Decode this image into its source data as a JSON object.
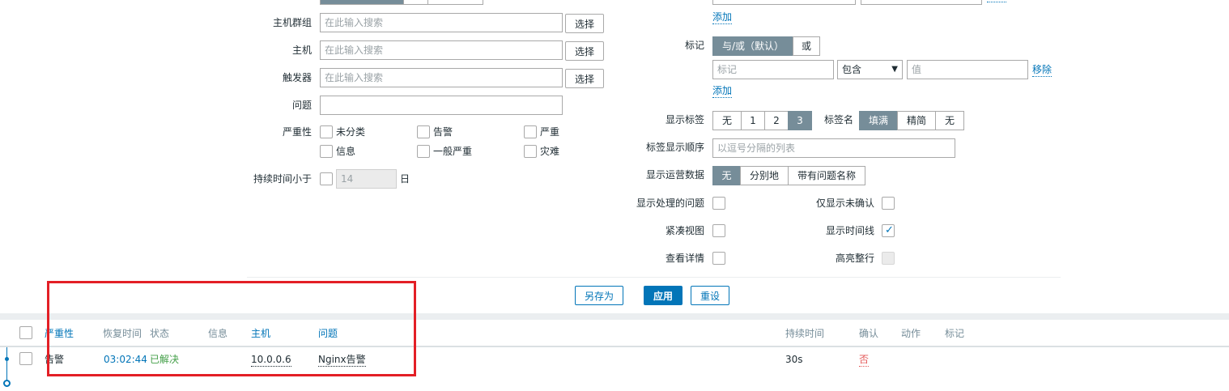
{
  "filter": {
    "host_groups": {
      "label": "主机群组",
      "placeholder": "在此输入搜索",
      "select_label": "选择"
    },
    "hosts": {
      "label": "主机",
      "placeholder": "在此输入搜索",
      "select_label": "选择"
    },
    "triggers": {
      "label": "触发器",
      "placeholder": "在此输入搜索",
      "select_label": "选择"
    },
    "problem": {
      "label": "问题",
      "value": ""
    },
    "severity": {
      "label": "严重性",
      "options": [
        "未分类",
        "告警",
        "严重",
        "信息",
        "一般严重",
        "灾难"
      ]
    },
    "age": {
      "label": "持续时间小于",
      "value": "14",
      "unit": "日"
    },
    "top_add_link": "添加",
    "tags": {
      "label": "标记",
      "operators": [
        "与/或（默认）",
        "或"
      ],
      "tag_placeholder": "标记",
      "condition": "包含",
      "value_placeholder": "值",
      "remove_label": "移除",
      "add_label": "添加"
    },
    "show_tags": {
      "label": "显示标签",
      "options": [
        "无",
        "1",
        "2",
        "3"
      ],
      "selected": "3"
    },
    "tag_name": {
      "label": "标签名",
      "options": [
        "填满",
        "精简",
        "无"
      ],
      "selected": "填满"
    },
    "tag_priority": {
      "label": "标签显示顺序",
      "placeholder": "以逗号分隔的列表"
    },
    "show_opdata": {
      "label": "显示运营数据",
      "options": [
        "无",
        "分别地",
        "带有问题名称"
      ],
      "selected": "无"
    },
    "show_suppressed": {
      "label": "显示处理的问题",
      "checked": false
    },
    "unacknowledged_only": {
      "label": "仅显示未确认",
      "checked": false
    },
    "compact_view": {
      "label": "紧凑视图",
      "checked": false
    },
    "show_timeline": {
      "label": "显示时间线",
      "checked": true
    },
    "show_details": {
      "label": "查看详情",
      "checked": false
    },
    "highlight_row": {
      "label": "高亮整行",
      "checked": false
    },
    "buttons": {
      "save_as": "另存为",
      "apply": "应用",
      "reset": "重设"
    }
  },
  "table": {
    "headers": {
      "severity": "严重性",
      "recovery_time": "恢复时间",
      "status": "状态",
      "info": "信息",
      "host": "主机",
      "problem": "问题",
      "duration": "持续时间",
      "ack": "确认",
      "actions": "动作",
      "tags": "标记"
    },
    "rows": [
      {
        "severity": "告警",
        "recovery_time": "03:02:44",
        "status": "已解决",
        "info": "",
        "host": "10.0.0.6",
        "problem": "Nginx告警",
        "duration": "30s",
        "ack": "否",
        "actions": "",
        "tags": ""
      }
    ]
  },
  "colors": {
    "accent": "#0275b8",
    "active_segment": "#768d99",
    "resolved": "#429e47",
    "ack_no": "#e45959",
    "highlight_box": "#e31f26"
  }
}
